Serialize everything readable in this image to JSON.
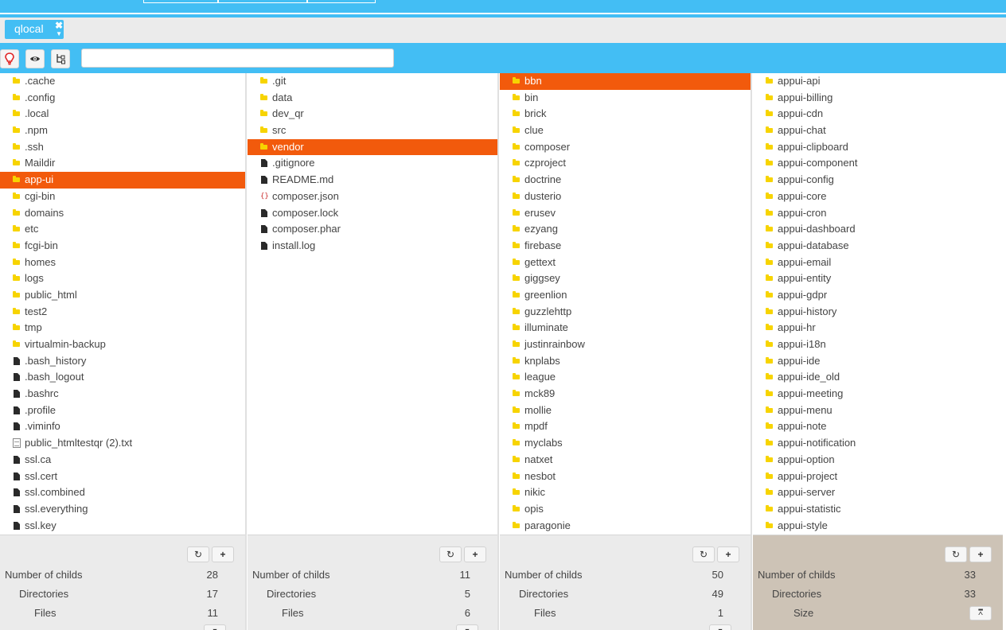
{
  "tab": {
    "label": "qlocal"
  },
  "search": {
    "placeholder": "",
    "value": ""
  },
  "columns": [
    {
      "items": [
        {
          "name": ".cache",
          "type": "folder"
        },
        {
          "name": ".config",
          "type": "folder"
        },
        {
          "name": ".local",
          "type": "folder"
        },
        {
          "name": ".npm",
          "type": "folder"
        },
        {
          "name": ".ssh",
          "type": "folder"
        },
        {
          "name": "Maildir",
          "type": "folder"
        },
        {
          "name": "app-ui",
          "type": "folder",
          "selected": true
        },
        {
          "name": "cgi-bin",
          "type": "folder"
        },
        {
          "name": "domains",
          "type": "folder"
        },
        {
          "name": "etc",
          "type": "folder"
        },
        {
          "name": "fcgi-bin",
          "type": "folder"
        },
        {
          "name": "homes",
          "type": "folder"
        },
        {
          "name": "logs",
          "type": "folder"
        },
        {
          "name": "public_html",
          "type": "folder"
        },
        {
          "name": "test2",
          "type": "folder"
        },
        {
          "name": "tmp",
          "type": "folder"
        },
        {
          "name": "virtualmin-backup",
          "type": "folder"
        },
        {
          "name": ".bash_history",
          "type": "file"
        },
        {
          "name": ".bash_logout",
          "type": "file"
        },
        {
          "name": ".bashrc",
          "type": "file"
        },
        {
          "name": ".profile",
          "type": "file"
        },
        {
          "name": ".viminfo",
          "type": "file"
        },
        {
          "name": "public_htmltestqr (2).txt",
          "type": "text"
        },
        {
          "name": "ssl.ca",
          "type": "file"
        },
        {
          "name": "ssl.cert",
          "type": "file"
        },
        {
          "name": "ssl.combined",
          "type": "file"
        },
        {
          "name": "ssl.everything",
          "type": "file"
        },
        {
          "name": "ssl.key",
          "type": "file"
        }
      ],
      "footer": {
        "childs_label": "Number of childs",
        "childs": "28",
        "dirs_label": "Directories",
        "dirs": "17",
        "files_label": "Files",
        "files": "11"
      }
    },
    {
      "items": [
        {
          "name": ".git",
          "type": "folder"
        },
        {
          "name": "data",
          "type": "folder"
        },
        {
          "name": "dev_qr",
          "type": "folder"
        },
        {
          "name": "src",
          "type": "folder"
        },
        {
          "name": "vendor",
          "type": "folder",
          "selected": true
        },
        {
          "name": ".gitignore",
          "type": "file"
        },
        {
          "name": "README.md",
          "type": "file"
        },
        {
          "name": "composer.json",
          "type": "json"
        },
        {
          "name": "composer.lock",
          "type": "file"
        },
        {
          "name": "composer.phar",
          "type": "file"
        },
        {
          "name": "install.log",
          "type": "file"
        }
      ],
      "footer": {
        "childs_label": "Number of childs",
        "childs": "11",
        "dirs_label": "Directories",
        "dirs": "5",
        "files_label": "Files",
        "files": "6"
      }
    },
    {
      "items": [
        {
          "name": "bbn",
          "type": "folder",
          "selected": true
        },
        {
          "name": "bin",
          "type": "folder"
        },
        {
          "name": "brick",
          "type": "folder"
        },
        {
          "name": "clue",
          "type": "folder"
        },
        {
          "name": "composer",
          "type": "folder"
        },
        {
          "name": "czproject",
          "type": "folder"
        },
        {
          "name": "doctrine",
          "type": "folder"
        },
        {
          "name": "dusterio",
          "type": "folder"
        },
        {
          "name": "erusev",
          "type": "folder"
        },
        {
          "name": "ezyang",
          "type": "folder"
        },
        {
          "name": "firebase",
          "type": "folder"
        },
        {
          "name": "gettext",
          "type": "folder"
        },
        {
          "name": "giggsey",
          "type": "folder"
        },
        {
          "name": "greenlion",
          "type": "folder"
        },
        {
          "name": "guzzlehttp",
          "type": "folder"
        },
        {
          "name": "illuminate",
          "type": "folder"
        },
        {
          "name": "justinrainbow",
          "type": "folder"
        },
        {
          "name": "knplabs",
          "type": "folder"
        },
        {
          "name": "league",
          "type": "folder"
        },
        {
          "name": "mck89",
          "type": "folder"
        },
        {
          "name": "mollie",
          "type": "folder"
        },
        {
          "name": "mpdf",
          "type": "folder"
        },
        {
          "name": "myclabs",
          "type": "folder"
        },
        {
          "name": "natxet",
          "type": "folder"
        },
        {
          "name": "nesbot",
          "type": "folder"
        },
        {
          "name": "nikic",
          "type": "folder"
        },
        {
          "name": "opis",
          "type": "folder"
        },
        {
          "name": "paragonie",
          "type": "folder"
        }
      ],
      "footer": {
        "childs_label": "Number of childs",
        "childs": "50",
        "dirs_label": "Directories",
        "dirs": "49",
        "files_label": "Files",
        "files": "1"
      }
    },
    {
      "items": [
        {
          "name": "appui-api",
          "type": "folder"
        },
        {
          "name": "appui-billing",
          "type": "folder"
        },
        {
          "name": "appui-cdn",
          "type": "folder"
        },
        {
          "name": "appui-chat",
          "type": "folder"
        },
        {
          "name": "appui-clipboard",
          "type": "folder"
        },
        {
          "name": "appui-component",
          "type": "folder"
        },
        {
          "name": "appui-config",
          "type": "folder"
        },
        {
          "name": "appui-core",
          "type": "folder"
        },
        {
          "name": "appui-cron",
          "type": "folder"
        },
        {
          "name": "appui-dashboard",
          "type": "folder"
        },
        {
          "name": "appui-database",
          "type": "folder"
        },
        {
          "name": "appui-email",
          "type": "folder"
        },
        {
          "name": "appui-entity",
          "type": "folder"
        },
        {
          "name": "appui-gdpr",
          "type": "folder"
        },
        {
          "name": "appui-history",
          "type": "folder"
        },
        {
          "name": "appui-hr",
          "type": "folder"
        },
        {
          "name": "appui-i18n",
          "type": "folder"
        },
        {
          "name": "appui-ide",
          "type": "folder"
        },
        {
          "name": "appui-ide_old",
          "type": "folder"
        },
        {
          "name": "appui-meeting",
          "type": "folder"
        },
        {
          "name": "appui-menu",
          "type": "folder"
        },
        {
          "name": "appui-note",
          "type": "folder"
        },
        {
          "name": "appui-notification",
          "type": "folder"
        },
        {
          "name": "appui-option",
          "type": "folder"
        },
        {
          "name": "appui-project",
          "type": "folder"
        },
        {
          "name": "appui-server",
          "type": "folder"
        },
        {
          "name": "appui-statistic",
          "type": "folder"
        },
        {
          "name": "appui-style",
          "type": "folder"
        }
      ],
      "footer": {
        "childs_label": "Number of childs",
        "childs": "33",
        "dirs_label": "Directories",
        "dirs": "33",
        "size_label": "Size"
      }
    }
  ]
}
